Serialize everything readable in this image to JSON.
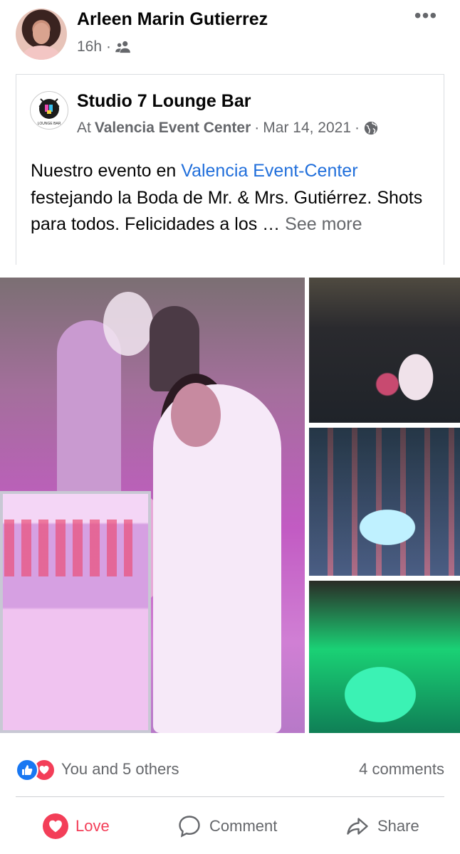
{
  "post": {
    "author": "Arleen Marin Gutierrez",
    "time": "16h",
    "separator": "·",
    "audience_icon": "friends-icon"
  },
  "shared": {
    "page_name": "Studio 7 Lounge Bar",
    "at_prefix": "At",
    "location": "Valencia Event Center",
    "date_separator": "·",
    "date": "Mar 14, 2021",
    "audience_separator": "·",
    "audience_icon": "globe-icon",
    "logo_text": "LOUNGE BAR",
    "text_before": "Nuestro evento en ",
    "text_link": "Valencia Event-Center",
    "text_after": " festejando la Boda de Mr. & Mrs. Gutiérrez. Shots para todos. Felicidades a los … ",
    "see_more": "See more"
  },
  "reactions": {
    "summary": "You and 5 others",
    "comments": "4 comments",
    "icons": [
      "like-icon",
      "love-icon"
    ]
  },
  "actions": {
    "love": "Love",
    "comment": "Comment",
    "share": "Share"
  },
  "colors": {
    "link": "#216fdb",
    "love": "#f33e58",
    "like": "#1877f2",
    "muted": "#65676b"
  }
}
